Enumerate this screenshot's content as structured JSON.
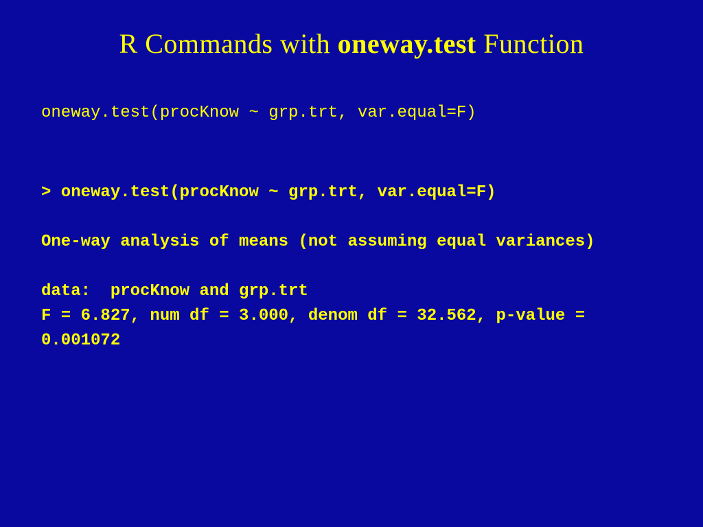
{
  "title": {
    "prefix": "R Commands with ",
    "bold": "oneway.test",
    "suffix": " Function"
  },
  "command": "oneway.test(procKnow ~ grp.trt, var.equal=F)",
  "output": "> oneway.test(procKnow ~ grp.trt, var.equal=F)\n\nOne-way analysis of means (not assuming equal variances)\n\ndata:  procKnow and grp.trt\nF = 6.827, num df = 3.000, denom df = 32.562, p-value = 0.001072"
}
